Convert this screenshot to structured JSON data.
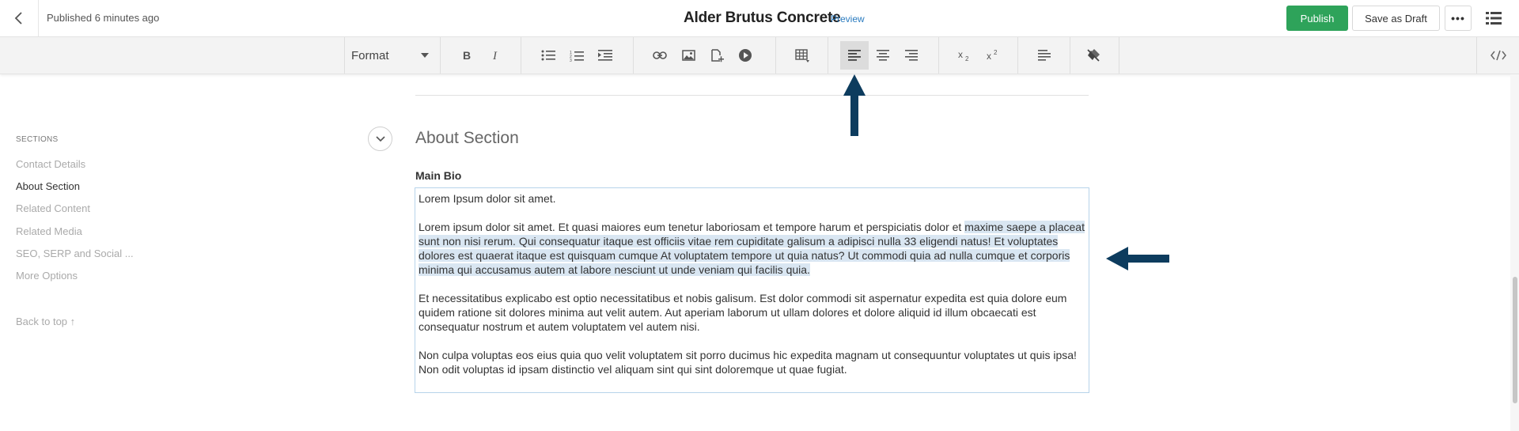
{
  "header": {
    "published_status": "Published 6 minutes ago",
    "title": "Alder Brutus Concrete",
    "preview_label": "Preview",
    "publish_label": "Publish",
    "save_draft_label": "Save as Draft",
    "more_label": "•••"
  },
  "toolbar": {
    "format_label": "Format",
    "active_button": "align-left",
    "accent_color": "#0d3c5e"
  },
  "sidebar": {
    "title": "SECTIONS",
    "items": [
      {
        "label": "Contact Details"
      },
      {
        "label": "About Section"
      },
      {
        "label": "Related Content"
      },
      {
        "label": "Related Media"
      },
      {
        "label": "SEO, SERP and Social ..."
      },
      {
        "label": "More Options"
      }
    ],
    "back_to_top": "Back to top ↑"
  },
  "main": {
    "section_title": "About Section",
    "field_label": "Main Bio",
    "editor": {
      "p1": "Lorem Ipsum dolor sit amet.",
      "p2_plain": "Lorem ipsum dolor sit amet. Et quasi maiores eum tenetur laboriosam et tempore harum et perspiciatis dolor et ",
      "p2_selected": "maxime saepe a placeat sunt non nisi rerum. Qui consequatur itaque est officiis vitae rem cupiditate galisum a adipisci nulla 33 eligendi natus! Et voluptates dolores est quaerat itaque est quisquam cumque At voluptatem tempore ut quia natus? Ut commodi quia ad nulla cumque et corporis minima qui accusamus autem at labore nesciunt ut unde veniam qui facilis quia.",
      "p3": "Et necessitatibus explicabo est optio necessitatibus et nobis galisum. Est dolor commodi sit aspernatur expedita est quia dolore eum quidem ratione sit dolores minima aut velit autem. Aut aperiam laborum ut ullam dolores et dolore aliquid id illum obcaecati est consequatur nostrum et autem voluptatem vel autem nisi.",
      "p4": "Non culpa voluptas eos eius quia quo velit voluptatem sit porro ducimus hic expedita magnam ut consequuntur voluptates ut quis ipsa! Non odit voluptas id ipsam distinctio vel aliquam sint qui sint doloremque ut quae fugiat."
    }
  }
}
